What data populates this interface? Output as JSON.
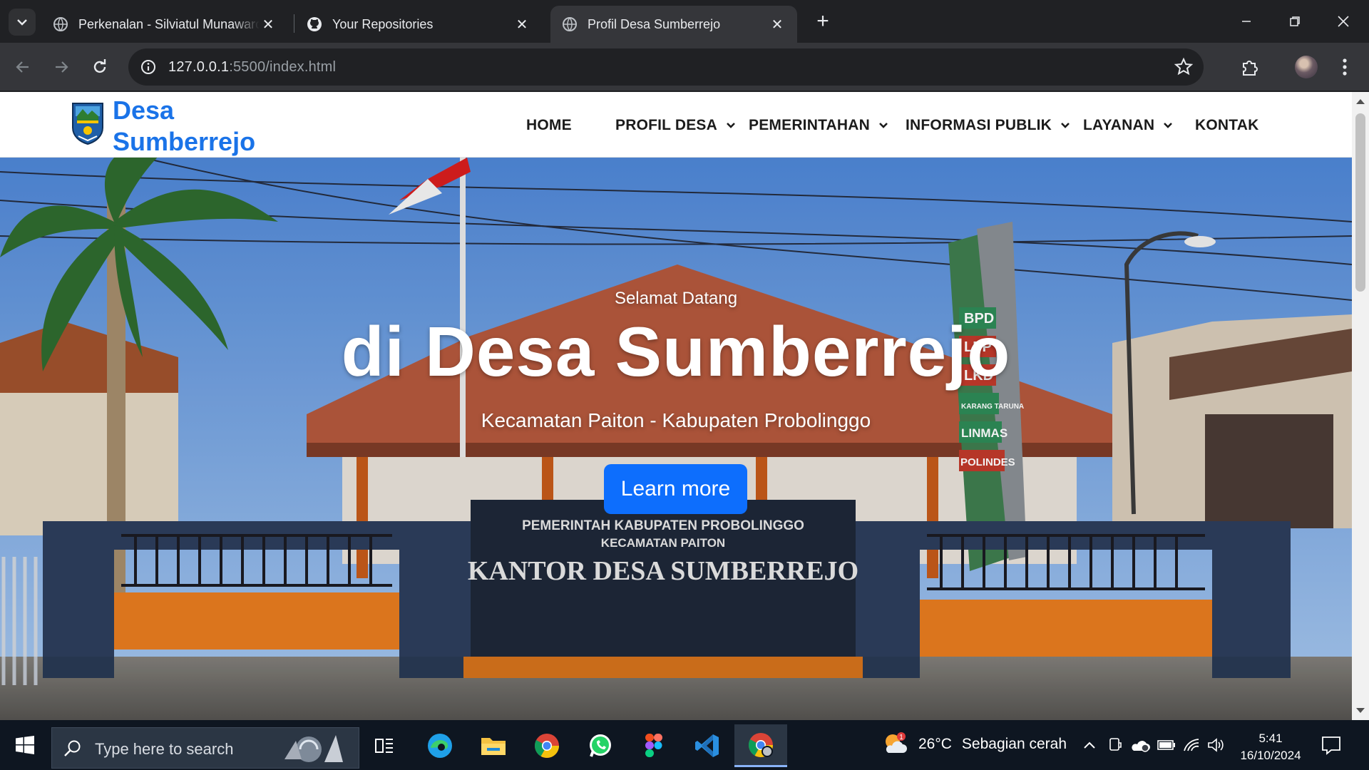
{
  "browser": {
    "tabs": [
      {
        "title": "Perkenalan - Silviatul Munawarc",
        "active": false
      },
      {
        "title": "Your Repositories",
        "active": false
      },
      {
        "title": "Profil Desa Sumberrejo",
        "active": true
      }
    ],
    "url": {
      "host": "127.0.0.1",
      "rest": ":5500/index.html"
    }
  },
  "site": {
    "brand_line1": "Desa",
    "brand_line2": "Sumberrejo",
    "nav": [
      {
        "label": "HOME",
        "dropdown": false
      },
      {
        "label": "PROFIL DESA",
        "dropdown": true
      },
      {
        "label": "PEMERINTAHAN",
        "dropdown": true
      },
      {
        "label": "INFORMASI PUBLIK",
        "dropdown": true
      },
      {
        "label": "LAYANAN",
        "dropdown": true
      },
      {
        "label": "KONTAK",
        "dropdown": false
      }
    ],
    "hero": {
      "greeting": "Selamat Datang",
      "title": "di Desa Sumberrejo",
      "subtitle": "Kecamatan Paiton - Kabupaten Probolinggo",
      "button": "Learn more",
      "sign_line1": "PEMERINTAH KABUPATEN PROBOLINGGO",
      "sign_line2": "KECAMATAN PAITON",
      "sign_line3": "KANTOR DESA SUMBERREJO",
      "pole_labels": [
        "BPD",
        "LPP",
        "LKD",
        "KARANG TARUNA",
        "LINMAS",
        "POLINDES"
      ]
    }
  },
  "taskbar": {
    "search_placeholder": "Type here to search",
    "weather_temp": "26°C",
    "weather_desc": "Sebagian cerah",
    "weather_badge": "1",
    "time": "5:41",
    "date": "16/10/2024"
  },
  "colors": {
    "brand": "#1a73e8",
    "button": "#0d6efd",
    "chrome_bg": "#202124",
    "taskbar": "#0e1621"
  }
}
